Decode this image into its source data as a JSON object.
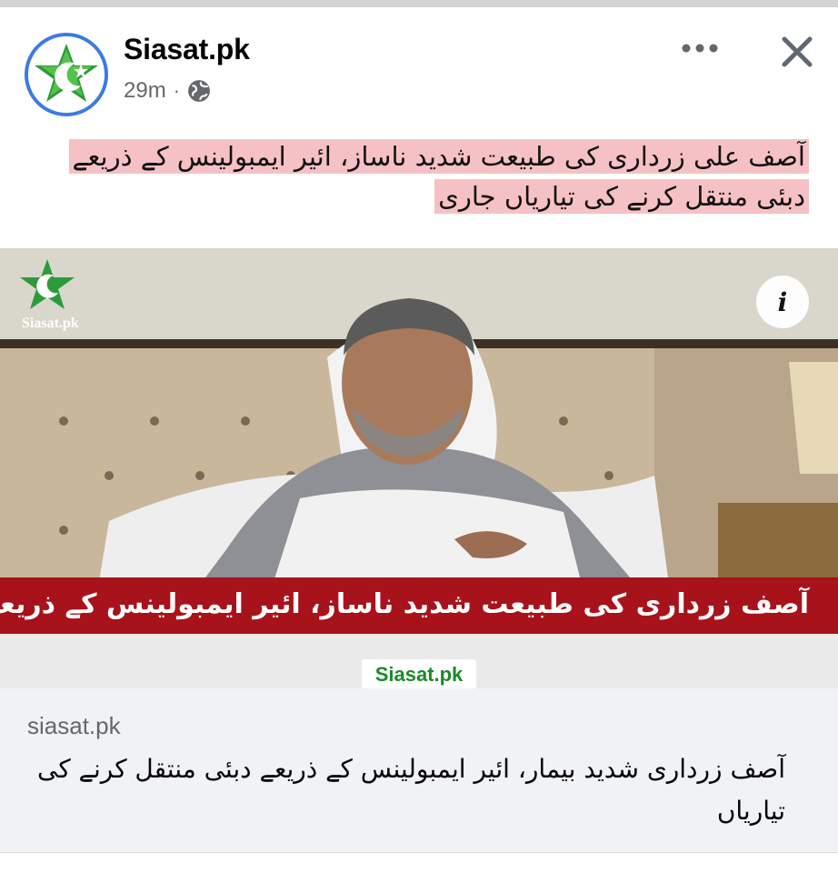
{
  "post": {
    "page_name": "Siasat.pk",
    "time_ago": "29m",
    "separator": "·",
    "privacy_icon": "globe-icon",
    "more_icon": "more-horizontal-icon",
    "close_icon": "close-icon",
    "caption_line1": "آصف علی زرداری کی طبیعت شدید ناساز، ائیر ایمبولینس کے ذریعے",
    "caption_line2": "دبئی منتقل کرنے کی تیاریاں جاری",
    "caption_highlight_color": "#f6c1c4"
  },
  "media": {
    "logo_label": "Siasat.pk",
    "info_label": "i",
    "banner_text": "آصف زرداری کی طبیعت شدید ناساز، ائیر ایمبولینس کے ذریعے دبئی منتقل کرنے کی تیاریاں جاری",
    "watermark": "Siasat.pk",
    "banner_color": "#a8121a"
  },
  "link_preview": {
    "domain": "siasat.pk",
    "title": "آصف زرداری شدید بیمار، ائیر ایمبولینس کے ذریعے دبئی منتقل کرنے کی تیاریاں"
  }
}
